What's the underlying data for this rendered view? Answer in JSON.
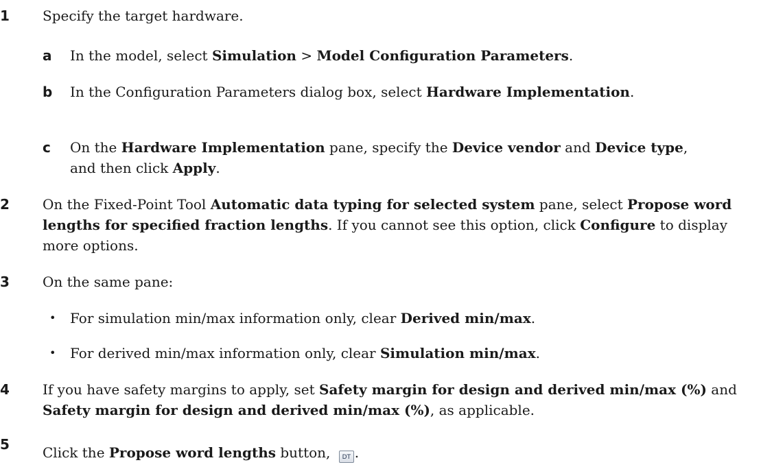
{
  "steps": [
    {
      "number": "1",
      "text": "Specify the target hardware.",
      "substeps": [
        {
          "letter": "a",
          "pre": "In the model, select ",
          "b1": "Simulation",
          "sep": " > ",
          "b2": "Model Configuration Parameters",
          "post": "."
        },
        {
          "letter": "b",
          "pre": "In the Configuration Parameters dialog box, select ",
          "b1": "Hardware Implementation",
          "post": "."
        },
        {
          "letter": "c",
          "pre": "On the ",
          "b1": "Hardware Implementation",
          "mid1": " pane, specify the ",
          "b2": "Device vendor",
          "mid2": " and ",
          "b3": "Device type",
          "mid3": ", and then click ",
          "b4": "Apply",
          "post": "."
        }
      ]
    },
    {
      "number": "2",
      "pre": "On the Fixed-Point Tool ",
      "b1": "Automatic data typing for selected system",
      "mid1": " pane, select ",
      "b2": "Propose word lengths for specified fraction lengths",
      "mid2": ". If you cannot see this option, click ",
      "b3": "Configure",
      "post": " to display more options."
    },
    {
      "number": "3",
      "text": "On the same pane:",
      "bullets": [
        {
          "marker": "•",
          "pre": "For simulation min/max information only, clear ",
          "b1": "Derived min/max",
          "post": "."
        },
        {
          "marker": "•",
          "pre": "For derived min/max information only, clear ",
          "b1": "Simulation min/max",
          "post": "."
        }
      ]
    },
    {
      "number": "4",
      "pre": "If you have safety margins to apply, set ",
      "b1": "Safety margin for design and derived min/max (%)",
      "mid1": " and ",
      "b2": "Safety margin for design and derived min/max (%)",
      "post": ", as applicable."
    },
    {
      "number": "5",
      "pre": "Click the ",
      "b1": "Propose word lengths",
      "mid1": " button, ",
      "icon_label": "DT",
      "icon_name": "propose-word-lengths-icon",
      "post": "."
    }
  ]
}
